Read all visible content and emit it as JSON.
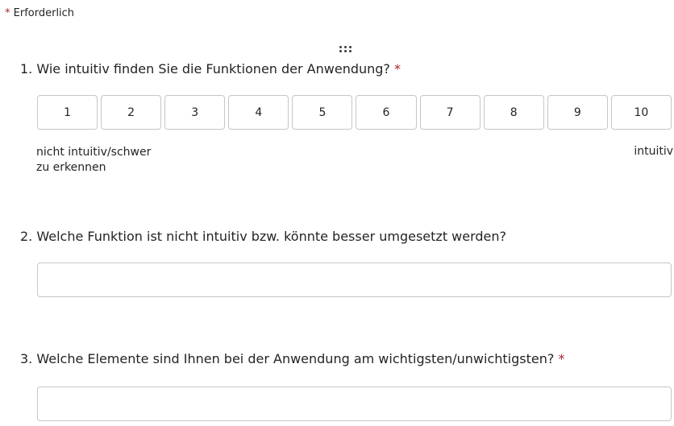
{
  "form": {
    "required_note": "Erforderlich",
    "required_marker": "*"
  },
  "questions": [
    {
      "number": "1.",
      "title": "1. Wie intuitiv finden Sie die Funktionen der Anwendung?",
      "required": true,
      "type": "rating-scale",
      "scale": [
        "1",
        "2",
        "3",
        "4",
        "5",
        "6",
        "7",
        "8",
        "9",
        "10"
      ],
      "label_left_line1": "nicht intuitiv/schwer",
      "label_left_line2": "zu erkennen",
      "label_right": "intuitiv"
    },
    {
      "number": "2.",
      "title": "2. Welche Funktion ist nicht intuitiv bzw. könnte besser umgesetzt werden?",
      "required": false,
      "type": "text",
      "value": ""
    },
    {
      "number": "3.",
      "title": "3. Welche Elemente sind Ihnen bei der Anwendung am wichtigsten/unwichtigsten?",
      "required": true,
      "type": "text",
      "value": ""
    }
  ],
  "icons": {
    "drag_handle": "drag-handle-icon"
  },
  "colors": {
    "required_star": "#a4262c",
    "border": "#c8c6c4",
    "text": "#242424"
  }
}
